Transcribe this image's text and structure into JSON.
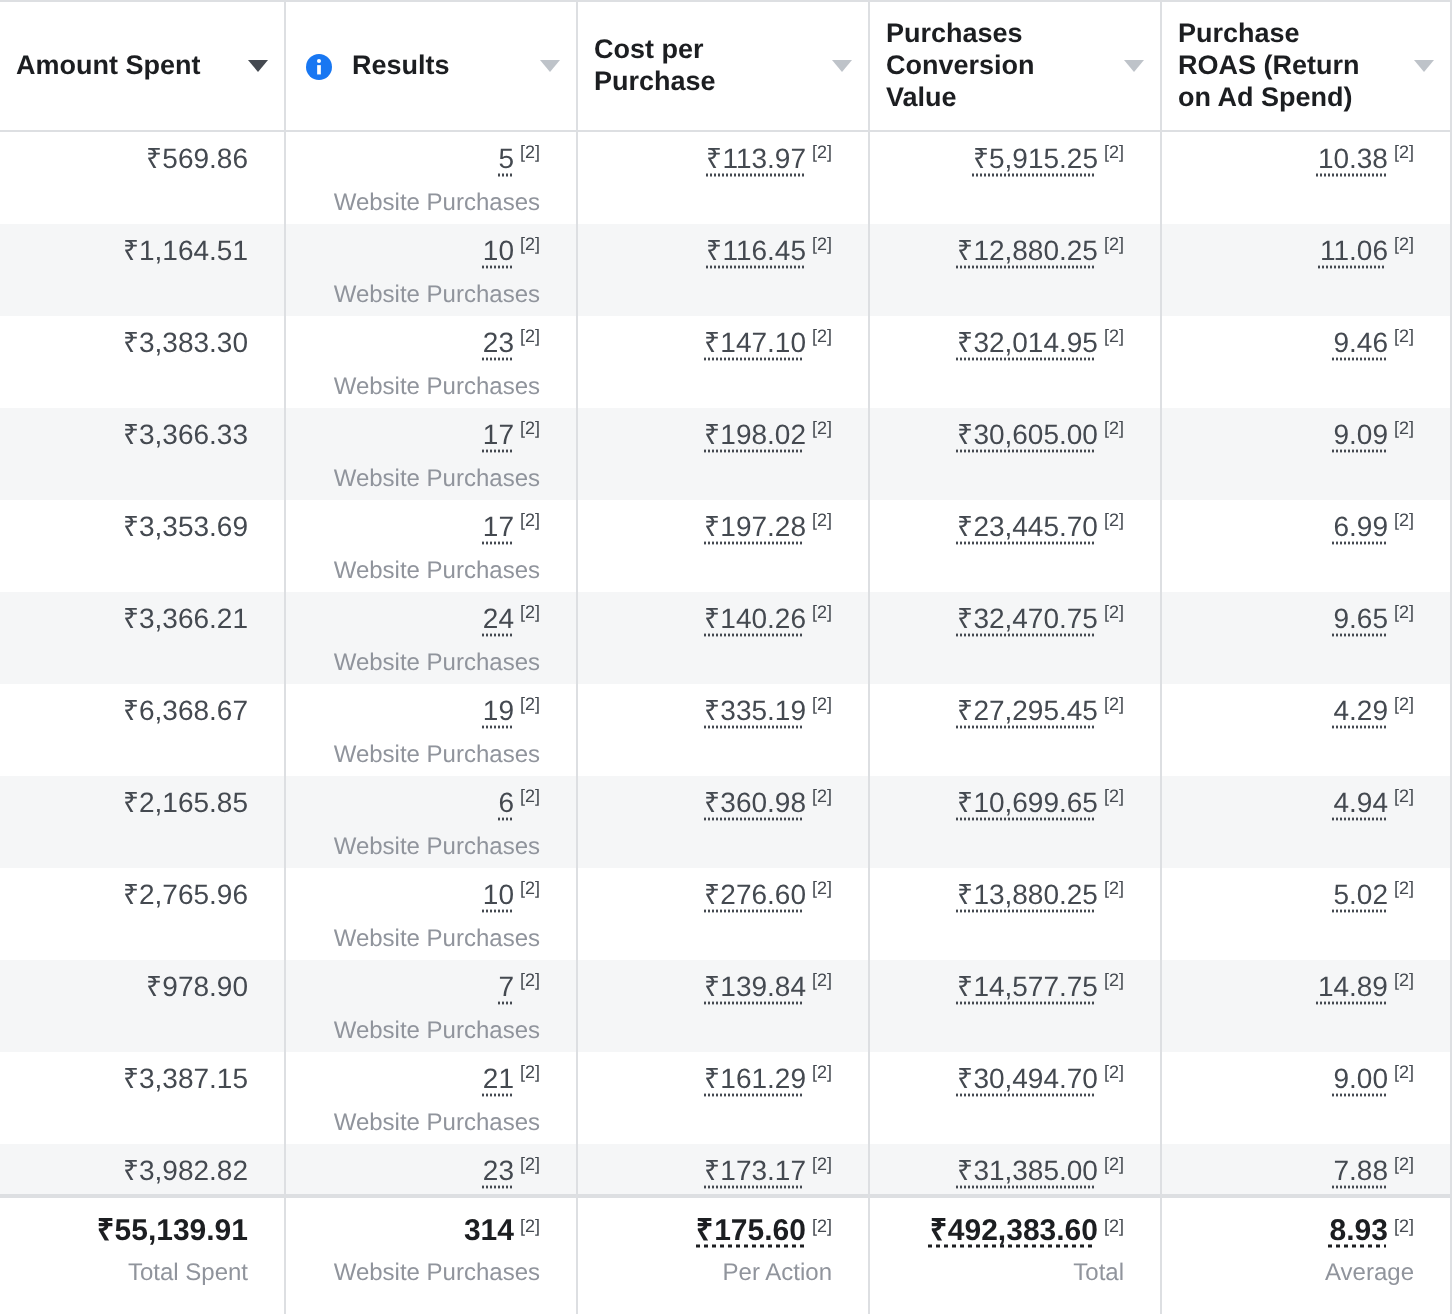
{
  "columns": [
    {
      "label": "Amount Spent",
      "sorted": true,
      "info": false
    },
    {
      "label": "Results",
      "sorted": false,
      "info": true
    },
    {
      "label": "Cost per Purchase",
      "sorted": false,
      "info": false
    },
    {
      "label": "Purchases Conversion Value",
      "sorted": false,
      "info": false
    },
    {
      "label": "Purchase ROAS (Return on Ad Spend)",
      "sorted": false,
      "info": false
    }
  ],
  "rows": [
    {
      "amount": "₹569.86",
      "results": "5",
      "results_note": "[2]",
      "results_label": "Website Purchases",
      "cost": "₹113.97",
      "cost_note": "[2]",
      "value": "₹5,915.25",
      "value_note": "[2]",
      "roas": "10.38",
      "roas_note": "[2]"
    },
    {
      "amount": "₹1,164.51",
      "results": "10",
      "results_note": "[2]",
      "results_label": "Website Purchases",
      "cost": "₹116.45",
      "cost_note": "[2]",
      "value": "₹12,880.25",
      "value_note": "[2]",
      "roas": "11.06",
      "roas_note": "[2]"
    },
    {
      "amount": "₹3,383.30",
      "results": "23",
      "results_note": "[2]",
      "results_label": "Website Purchases",
      "cost": "₹147.10",
      "cost_note": "[2]",
      "value": "₹32,014.95",
      "value_note": "[2]",
      "roas": "9.46",
      "roas_note": "[2]"
    },
    {
      "amount": "₹3,366.33",
      "results": "17",
      "results_note": "[2]",
      "results_label": "Website Purchases",
      "cost": "₹198.02",
      "cost_note": "[2]",
      "value": "₹30,605.00",
      "value_note": "[2]",
      "roas": "9.09",
      "roas_note": "[2]"
    },
    {
      "amount": "₹3,353.69",
      "results": "17",
      "results_note": "[2]",
      "results_label": "Website Purchases",
      "cost": "₹197.28",
      "cost_note": "[2]",
      "value": "₹23,445.70",
      "value_note": "[2]",
      "roas": "6.99",
      "roas_note": "[2]"
    },
    {
      "amount": "₹3,366.21",
      "results": "24",
      "results_note": "[2]",
      "results_label": "Website Purchases",
      "cost": "₹140.26",
      "cost_note": "[2]",
      "value": "₹32,470.75",
      "value_note": "[2]",
      "roas": "9.65",
      "roas_note": "[2]"
    },
    {
      "amount": "₹6,368.67",
      "results": "19",
      "results_note": "[2]",
      "results_label": "Website Purchases",
      "cost": "₹335.19",
      "cost_note": "[2]",
      "value": "₹27,295.45",
      "value_note": "[2]",
      "roas": "4.29",
      "roas_note": "[2]"
    },
    {
      "amount": "₹2,165.85",
      "results": "6",
      "results_note": "[2]",
      "results_label": "Website Purchases",
      "cost": "₹360.98",
      "cost_note": "[2]",
      "value": "₹10,699.65",
      "value_note": "[2]",
      "roas": "4.94",
      "roas_note": "[2]"
    },
    {
      "amount": "₹2,765.96",
      "results": "10",
      "results_note": "[2]",
      "results_label": "Website Purchases",
      "cost": "₹276.60",
      "cost_note": "[2]",
      "value": "₹13,880.25",
      "value_note": "[2]",
      "roas": "5.02",
      "roas_note": "[2]"
    },
    {
      "amount": "₹978.90",
      "results": "7",
      "results_note": "[2]",
      "results_label": "Website Purchases",
      "cost": "₹139.84",
      "cost_note": "[2]",
      "value": "₹14,577.75",
      "value_note": "[2]",
      "roas": "14.89",
      "roas_note": "[2]"
    },
    {
      "amount": "₹3,387.15",
      "results": "21",
      "results_note": "[2]",
      "results_label": "Website Purchases",
      "cost": "₹161.29",
      "cost_note": "[2]",
      "value": "₹30,494.70",
      "value_note": "[2]",
      "roas": "9.00",
      "roas_note": "[2]"
    },
    {
      "amount": "₹3,982.82",
      "results": "23",
      "results_note": "[2]",
      "cost": "₹173.17",
      "cost_note": "[2]",
      "value": "₹31,385.00",
      "value_note": "[2]",
      "roas": "7.88",
      "roas_note": "[2]"
    }
  ],
  "totals": [
    {
      "value": "₹55,139.91",
      "label": "Total Spent",
      "underlined": false
    },
    {
      "value": "314",
      "note": "[2]",
      "label": "Website Purchases",
      "underlined": false
    },
    {
      "value": "₹175.60",
      "note": "[2]",
      "label": "Per Action",
      "underlined": true
    },
    {
      "value": "₹492,383.60",
      "note": "[2]",
      "label": "Total",
      "underlined": true
    },
    {
      "value": "8.93",
      "note": "[2]",
      "label": "Average",
      "underlined": true
    }
  ]
}
